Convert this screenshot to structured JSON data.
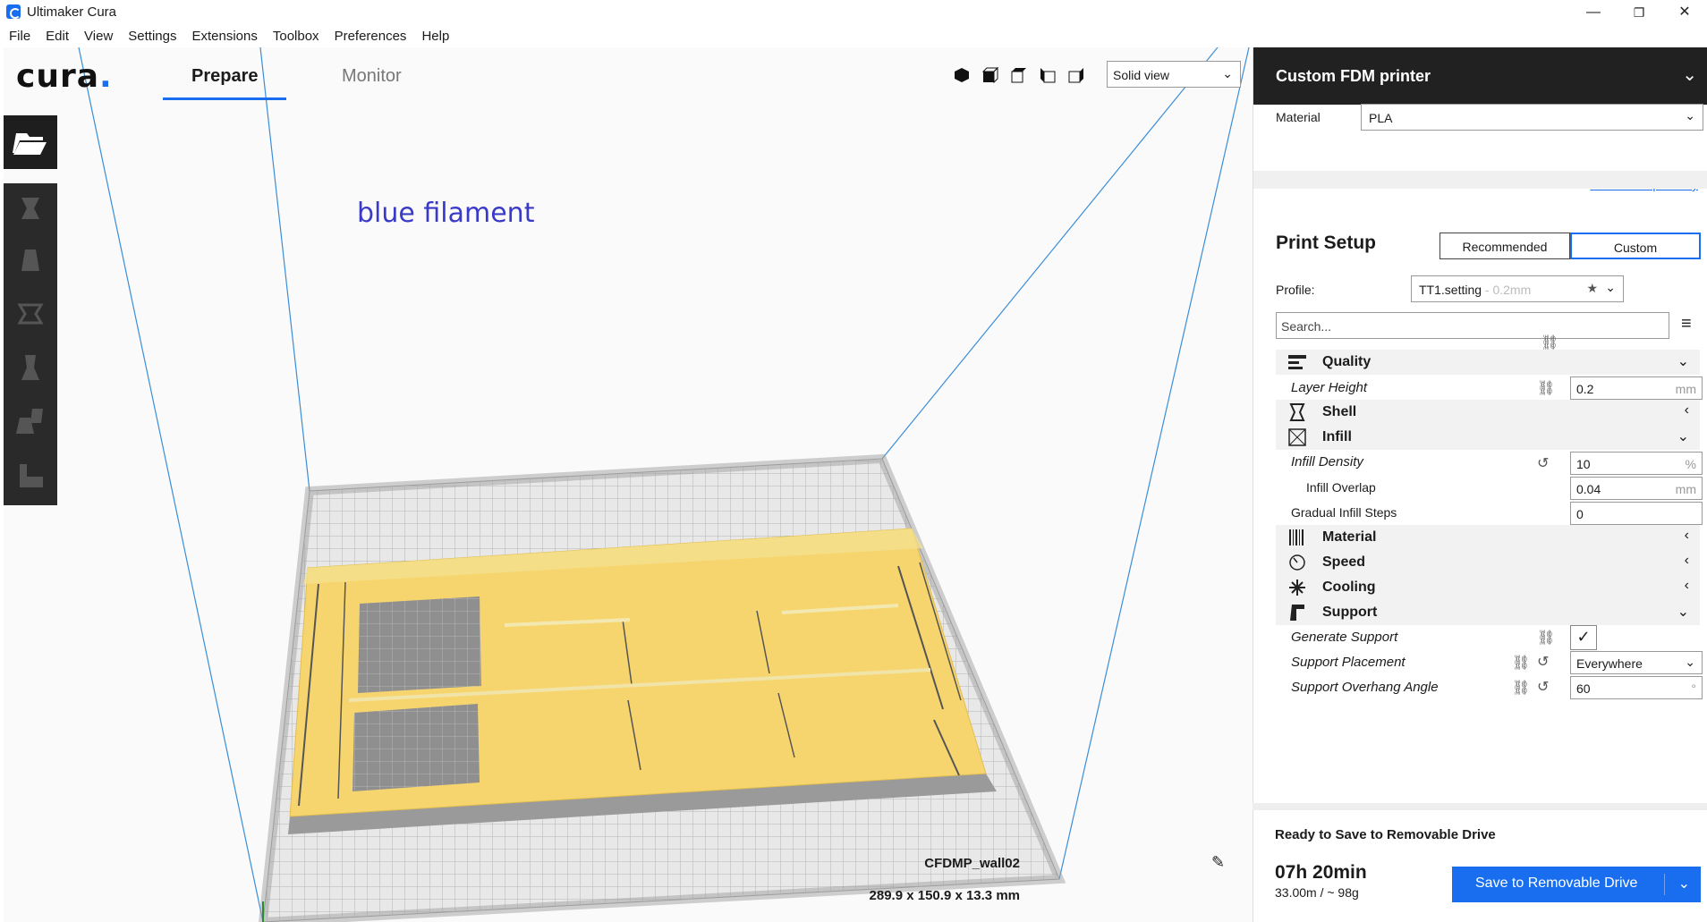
{
  "window": {
    "title": "Ultimaker Cura",
    "minimize": "—",
    "maximize": "❐",
    "close": "✕"
  },
  "menu": [
    "File",
    "Edit",
    "View",
    "Settings",
    "Extensions",
    "Toolbox",
    "Preferences",
    "Help"
  ],
  "header": {
    "logo": "cura",
    "logo_dot": ".",
    "tabs": [
      {
        "label": "Prepare",
        "active": true
      },
      {
        "label": "Monitor",
        "active": false
      }
    ],
    "view_select": "Solid view"
  },
  "viewport": {
    "annotation": "blue filament",
    "object_name": "CFDMP_wall02",
    "object_dims": "289.9 x 150.9 x 13.3 mm"
  },
  "panel": {
    "printer": "Custom FDM printer",
    "material_label": "Material",
    "material_value": "PLA",
    "check_compat": "Check compatibility",
    "print_setup": "Print Setup",
    "mode_recommended": "Recommended",
    "mode_custom": "Custom",
    "profile_label": "Profile:",
    "profile_value": "TT1.setting",
    "profile_suffix": " - 0.2mm",
    "search_placeholder": "Search...",
    "categories": {
      "quality": "Quality",
      "shell": "Shell",
      "infill": "Infill",
      "material": "Material",
      "speed": "Speed",
      "cooling": "Cooling",
      "support": "Support"
    },
    "settings": {
      "layer_height": {
        "label": "Layer Height",
        "value": "0.2",
        "unit": "mm"
      },
      "infill_density": {
        "label": "Infill Density",
        "value": "10",
        "unit": "%"
      },
      "infill_overlap": {
        "label": "Infill Overlap",
        "value": "0.04",
        "unit": "mm"
      },
      "gradual_infill": {
        "label": "Gradual Infill Steps",
        "value": "0"
      },
      "generate_support": {
        "label": "Generate Support",
        "checked": true
      },
      "support_placement": {
        "label": "Support Placement",
        "value": "Everywhere"
      },
      "support_angle": {
        "label": "Support Overhang Angle",
        "value": "60",
        "unit": "°"
      }
    },
    "footer": {
      "status": "Ready to Save to Removable Drive",
      "time": "07h 20min",
      "length": "33.00m / ~ 98g",
      "save_button": "Save to Removable Drive"
    }
  },
  "colors": {
    "accent": "#196ef0",
    "model": "#f7d56e",
    "dark_bar": "#212121"
  }
}
